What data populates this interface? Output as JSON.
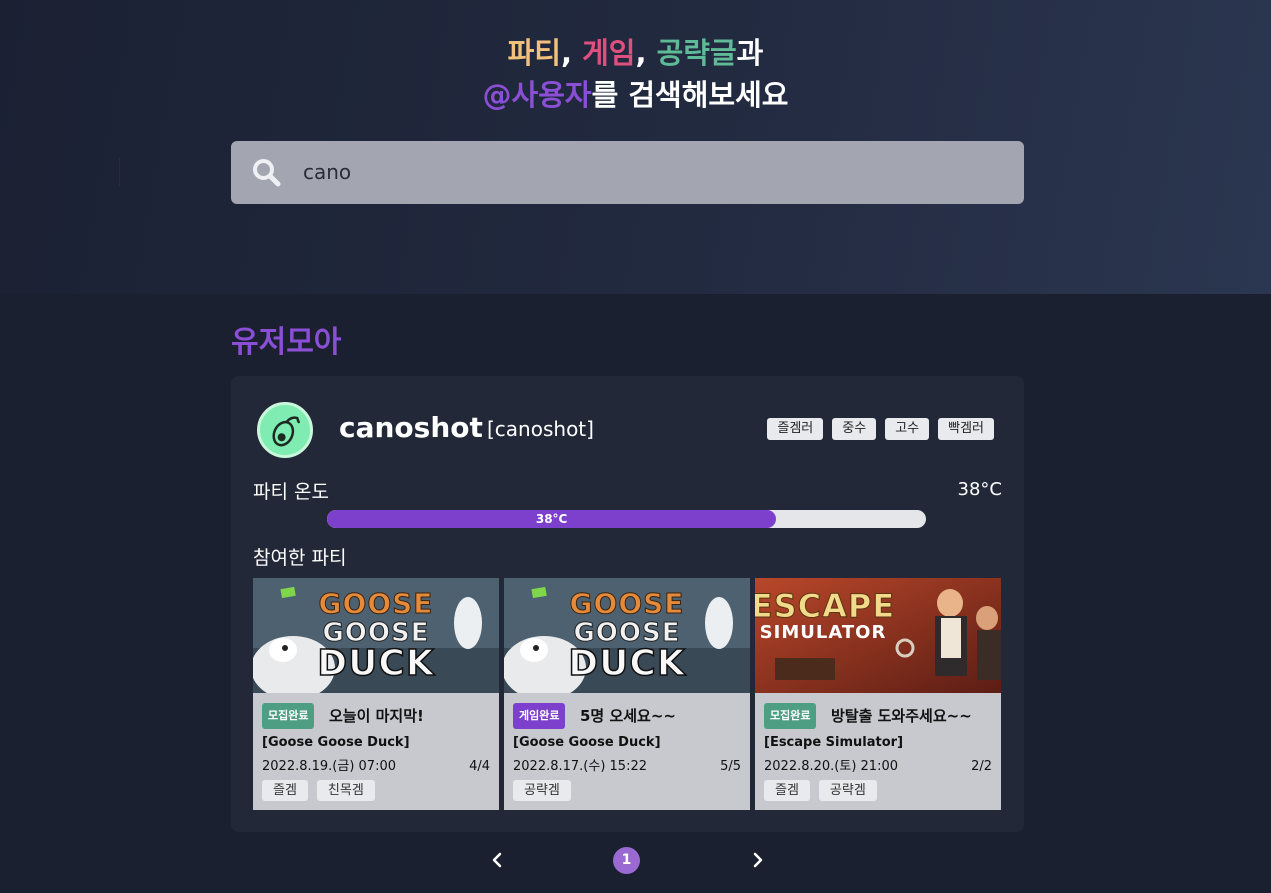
{
  "headline": {
    "line1": [
      {
        "text": "파티",
        "color": "#f2c27c"
      },
      {
        "text": ", ",
        "color": "#ffffff"
      },
      {
        "text": "게임",
        "color": "#e0507e"
      },
      {
        "text": ", ",
        "color": "#ffffff"
      },
      {
        "text": "공략글",
        "color": "#5fba98"
      },
      {
        "text": "과",
        "color": "#ffffff"
      }
    ],
    "line2": [
      {
        "text": "@사용자",
        "color": "#8a4fd4"
      },
      {
        "text": "를 검색해보세요",
        "color": "#ffffff"
      }
    ]
  },
  "search": {
    "value": "cano",
    "icon": "search-icon"
  },
  "section_title": "유저모아",
  "user": {
    "nickname": "canoshot",
    "id_label": "[canoshot]",
    "avatar_icon": "avocado-avatar-icon",
    "tags": [
      "즐겜러",
      "중수",
      "고수",
      "빡겜러"
    ],
    "temperature_label": "파티 온도",
    "temperature_value": "38°C",
    "temperature_bar_label": "38°C",
    "temperature_fraction": 0.75
  },
  "parties_label": "참여한 파티",
  "parties": [
    {
      "thumb_title": "GOOSE GOOSE DUCK",
      "status": "모집완료",
      "status_color": "#4e9e84",
      "title": "오늘이 마지막!",
      "game": "[Goose Goose Duck]",
      "date": "2022.8.19.(금) 07:00",
      "count": "4/4",
      "tags": [
        "즐겜",
        "친목겜"
      ]
    },
    {
      "thumb_title": "GOOSE GOOSE DUCK",
      "status": "게임완료",
      "status_color": "#7d40cc",
      "title": "5명 오세요~~",
      "game": "[Goose Goose Duck]",
      "date": "2022.8.17.(수) 15:22",
      "count": "5/5",
      "tags": [
        "공략겜"
      ]
    },
    {
      "thumb_title": "ESCAPE SIMULATOR",
      "status": "모집완료",
      "status_color": "#4e9e84",
      "title": "방탈출 도와주세요~~",
      "game": "[Escape Simulator]",
      "date": "2022.8.20.(토) 21:00",
      "count": "2/2",
      "tags": [
        "즐겜",
        "공략겜"
      ]
    }
  ],
  "pagination": {
    "current": "1"
  }
}
